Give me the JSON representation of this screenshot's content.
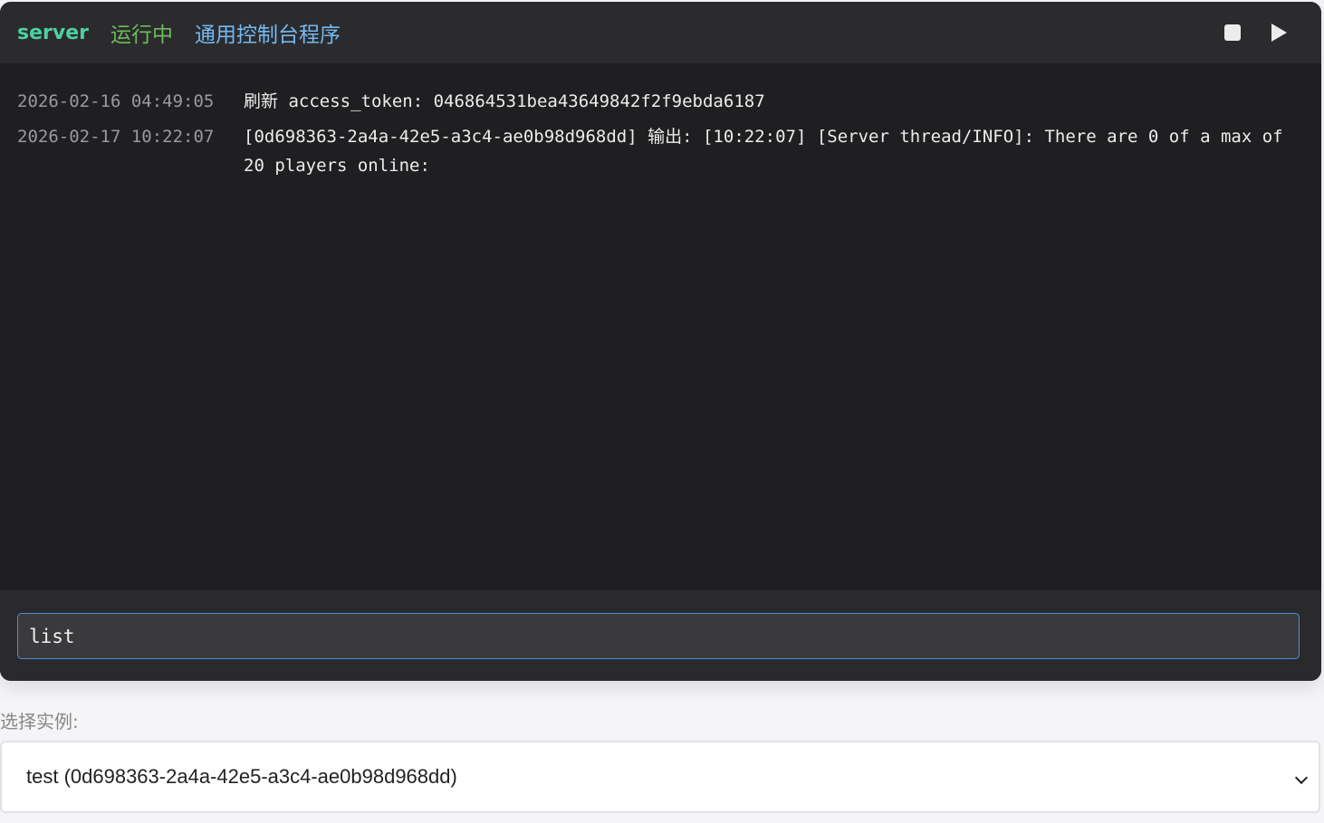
{
  "header": {
    "server_name": "server",
    "status": "运行中",
    "program_type": "通用控制台程序",
    "accent_color": "#4dd0a1",
    "status_color": "#6dbb5c",
    "program_color": "#74b9f2",
    "stop_icon": "stop-icon",
    "play_icon": "play-icon"
  },
  "log": {
    "entries": [
      {
        "time": "2026-02-16 04:49:05",
        "message": "刷新 access_token: 046864531bea43649842f2f9ebda6187"
      },
      {
        "time": "2026-02-17 10:22:07",
        "message": "[0d698363-2a4a-42e5-a3c4-ae0b98d968dd] 输出: [10:22:07] [Server thread/INFO]: There are 0 of a max of 20 players online:"
      }
    ]
  },
  "command_input": {
    "value": "list",
    "placeholder": ""
  },
  "instance_select": {
    "label": "选择实例:",
    "selected": "test (0d698363-2a4a-42e5-a3c4-ae0b98d968dd)"
  }
}
